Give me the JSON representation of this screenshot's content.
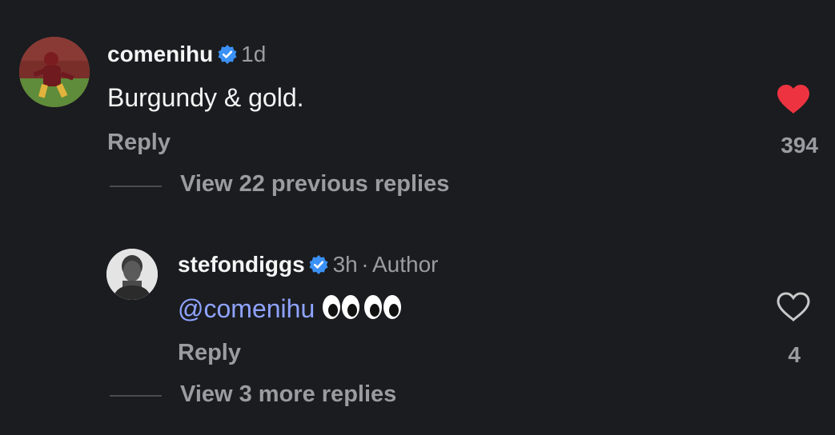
{
  "comment": {
    "username": "comenihu",
    "verified_icon": "verified-badge-icon",
    "time": "1d",
    "text": "Burgundy & gold.",
    "reply_label": "Reply",
    "like_count": "394",
    "liked": true,
    "heart_color": "#ee3340",
    "view_replies_label": "View 22 previous replies"
  },
  "reply": {
    "username": "stefondiggs",
    "verified_icon": "verified-badge-icon",
    "time": "3h",
    "separator": "·",
    "author_label": "Author",
    "mention": "@comenihu",
    "emoji_icon": "eyes-emoji-icon",
    "reply_label": "Reply",
    "like_count": "4",
    "liked": false,
    "view_replies_label": "View 3 more replies"
  },
  "colors": {
    "background": "#1a1c20",
    "verified_badge": "#3b91f5",
    "mention": "#8fa3ff",
    "secondary_text": "#9a9ca1"
  }
}
